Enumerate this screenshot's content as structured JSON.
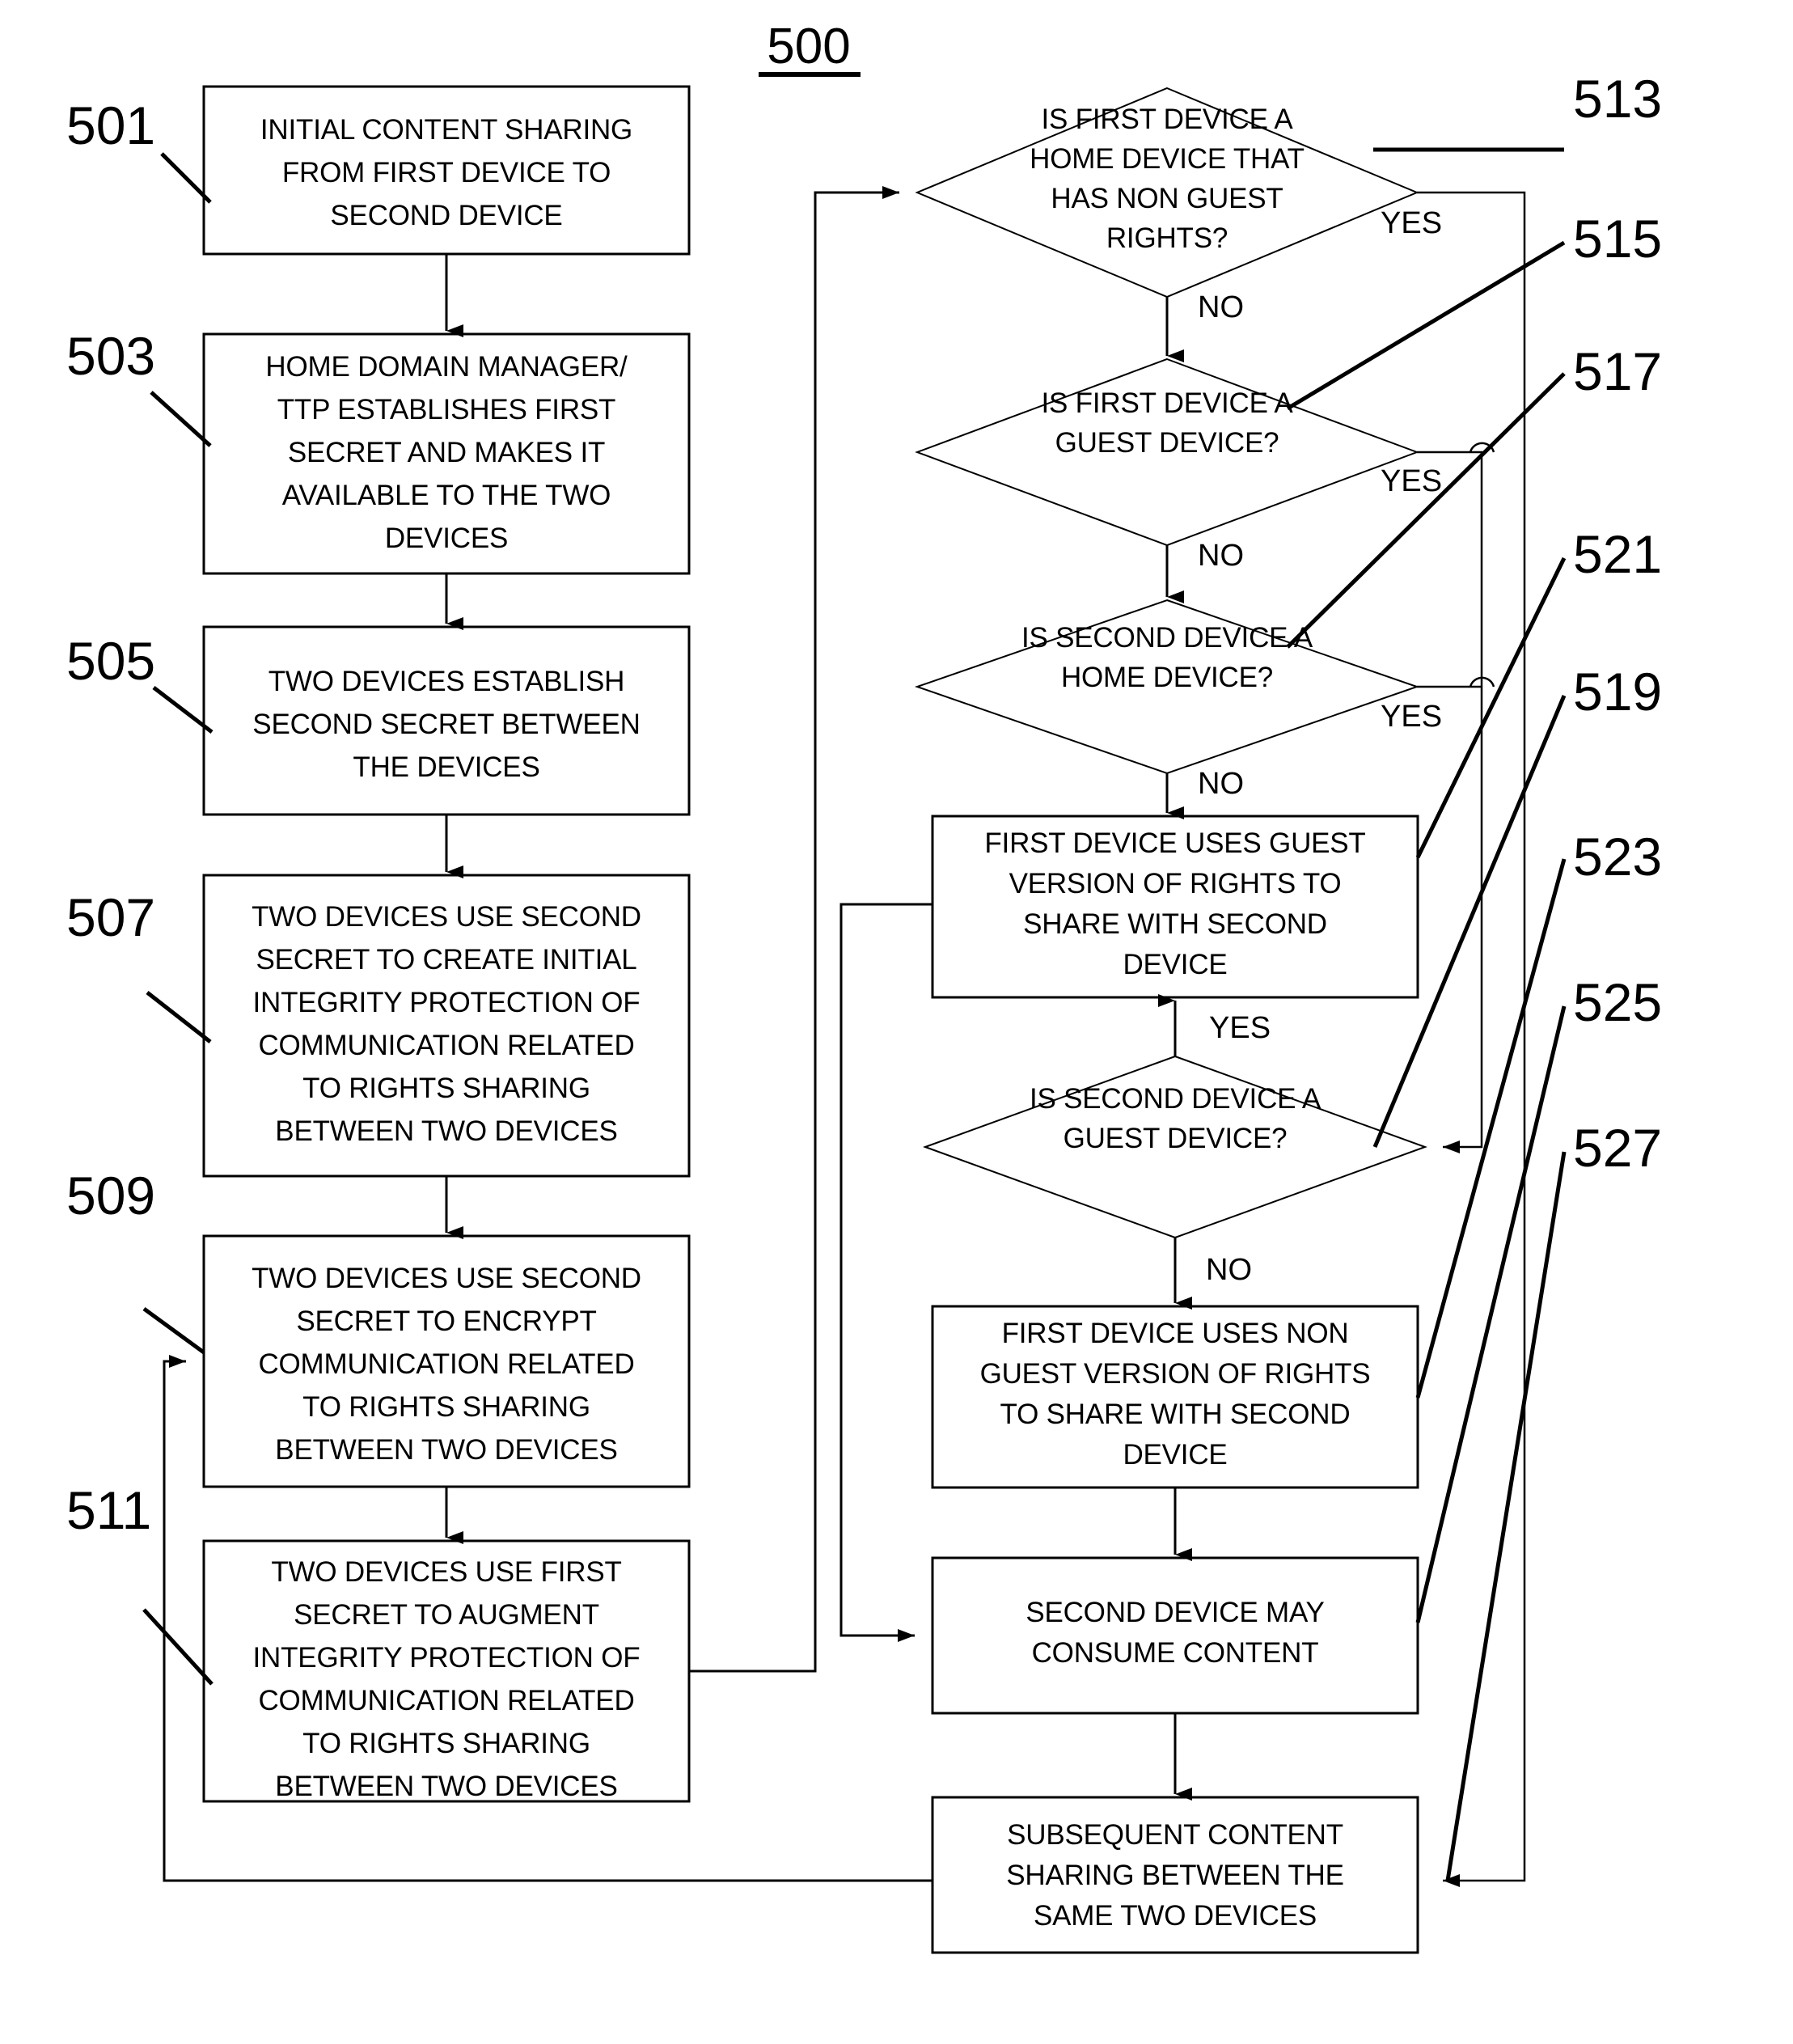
{
  "figure": {
    "number": "500",
    "underline": true
  },
  "nodes": [
    {
      "id": "501",
      "ref": "501",
      "type": "process",
      "lines": [
        "INITIAL CONTENT SHARING",
        "FROM FIRST DEVICE TO",
        "SECOND DEVICE"
      ]
    },
    {
      "id": "503",
      "ref": "503",
      "type": "process",
      "lines": [
        "HOME DOMAIN MANAGER/",
        "TTP ESTABLISHES FIRST",
        "SECRET AND MAKES IT",
        "AVAILABLE TO THE TWO",
        "DEVICES"
      ]
    },
    {
      "id": "505",
      "ref": "505",
      "type": "process",
      "lines": [
        "TWO DEVICES ESTABLISH",
        "SECOND SECRET BETWEEN",
        "THE DEVICES"
      ]
    },
    {
      "id": "507",
      "ref": "507",
      "type": "process",
      "lines": [
        "TWO DEVICES USE SECOND",
        "SECRET TO CREATE INITIAL",
        "INTEGRITY PROTECTION OF",
        "COMMUNICATION RELATED",
        "TO RIGHTS SHARING",
        "BETWEEN TWO DEVICES"
      ]
    },
    {
      "id": "509",
      "ref": "509",
      "type": "process",
      "lines": [
        "TWO DEVICES USE SECOND",
        "SECRET TO ENCRYPT",
        "COMMUNICATION RELATED",
        "TO RIGHTS SHARING",
        "BETWEEN TWO DEVICES"
      ]
    },
    {
      "id": "511",
      "ref": "511",
      "type": "process",
      "lines": [
        "TWO DEVICES USE FIRST",
        "SECRET TO AUGMENT",
        "INTEGRITY PROTECTION OF",
        "COMMUNICATION RELATED",
        "TO RIGHTS SHARING",
        "BETWEEN TWO DEVICES"
      ]
    },
    {
      "id": "513",
      "ref": "513",
      "type": "decision",
      "lines": [
        "IS FIRST DEVICE A",
        "HOME DEVICE THAT",
        "HAS NON GUEST",
        "RIGHTS?"
      ]
    },
    {
      "id": "515",
      "ref": "515",
      "type": "decision",
      "lines": [
        "IS FIRST DEVICE A",
        "GUEST DEVICE?"
      ]
    },
    {
      "id": "517",
      "ref": "517",
      "type": "decision",
      "lines": [
        "IS SECOND DEVICE A",
        "HOME DEVICE?"
      ]
    },
    {
      "id": "519",
      "ref": "519",
      "type": "decision",
      "lines": [
        "IS SECOND DEVICE A",
        "GUEST DEVICE?"
      ]
    },
    {
      "id": "521",
      "ref": "521",
      "type": "process",
      "lines": [
        "FIRST DEVICE USES GUEST",
        "VERSION OF RIGHTS TO",
        "SHARE WITH SECOND",
        "DEVICE"
      ]
    },
    {
      "id": "523",
      "ref": "523",
      "type": "process",
      "lines": [
        "FIRST DEVICE USES NON",
        "GUEST VERSION OF RIGHTS",
        "TO SHARE WITH SECOND",
        "DEVICE"
      ]
    },
    {
      "id": "525",
      "ref": "525",
      "type": "process",
      "lines": [
        "SECOND DEVICE MAY",
        "CONSUME CONTENT"
      ]
    },
    {
      "id": "527",
      "ref": "527",
      "type": "process",
      "lines": [
        "SUBSEQUENT CONTENT",
        "SHARING BETWEEN THE",
        "SAME TWO DEVICES"
      ]
    }
  ],
  "branch_labels": {
    "b513_yes": "YES",
    "b513_no": "NO",
    "b515_yes": "YES",
    "b515_no": "NO",
    "b517_yes": "YES",
    "b517_no": "NO",
    "b519_yes": "YES",
    "b519_no": "NO"
  },
  "colors": {
    "stroke": "#000000",
    "fill": "#ffffff",
    "text": "#000000"
  }
}
